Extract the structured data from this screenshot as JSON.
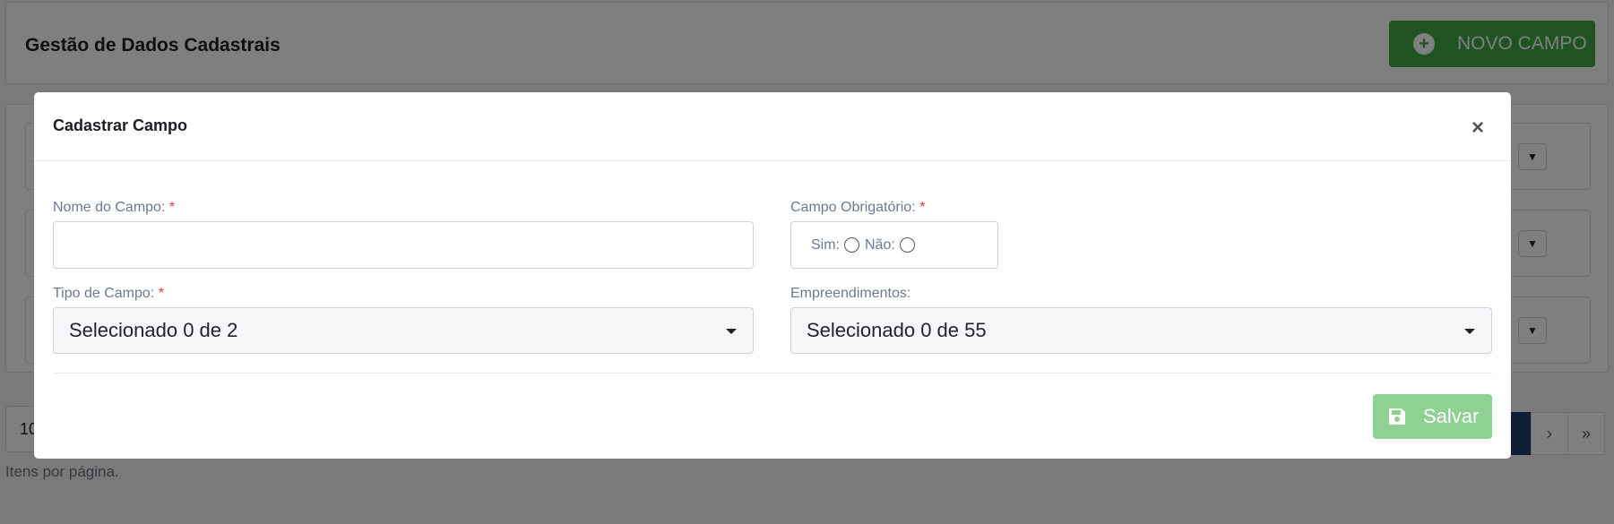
{
  "page": {
    "title": "Gestão de Dados Cadastrais",
    "new_button_label": "NOVO CAMPO",
    "pager_size_value": "10",
    "pager_next": "›",
    "pager_last": "»",
    "items_per_page_label": "Itens por página."
  },
  "modal": {
    "title": "Cadastrar Campo",
    "close_symbol": "×",
    "field_name_label": "Nome do Campo:",
    "field_name_value": "",
    "required_label": "Campo Obrigatório:",
    "required_yes": "Sim:",
    "required_no": "Não:",
    "field_type_label": "Tipo de Campo:",
    "field_type_value": "Selecionado 0 de 2",
    "projects_label": "Empreendimentos:",
    "projects_value": "Selecionado 0 de 55",
    "required_marker": "*",
    "save_label": "Salvar"
  },
  "colors": {
    "success": "#3ea644",
    "success_disabled": "#8fd093",
    "required": "#e03b3b",
    "pager_active": "#1e3a6b"
  },
  "icons": {
    "new": "plus-circle-icon",
    "close": "close-icon",
    "dropdown": "caret-down-icon",
    "save": "floppy-disk-icon"
  }
}
